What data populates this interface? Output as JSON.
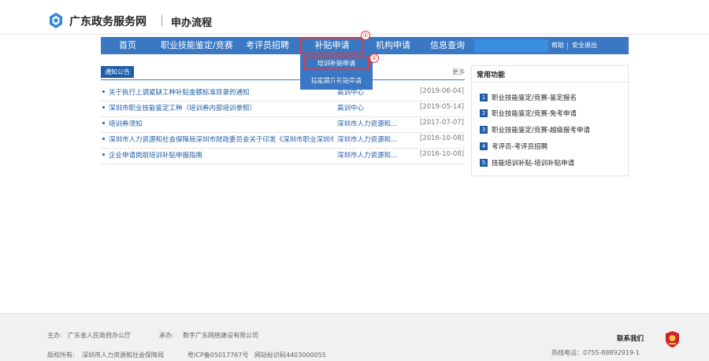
{
  "header": {
    "site_title": "广东政务服务网",
    "page_title": "申办流程"
  },
  "nav": {
    "items": [
      "首页",
      "职业技能鉴定/竞赛",
      "考评员招聘",
      "补贴申请",
      "机构申请",
      "信息查询"
    ],
    "active_item": "补贴申请",
    "search_value": "",
    "help_label": "帮助",
    "logout_label": "安全退出"
  },
  "dropdown": {
    "items": [
      "培训补贴申请",
      "技能提升补贴申请"
    ]
  },
  "markers": [
    "①",
    "②"
  ],
  "notices": {
    "tag": "通知公告",
    "more": "更多",
    "items": [
      {
        "title": "关于执行上调紧缺工种补贴金额标准目录的通知",
        "source": "高训中心",
        "date": "[2019-06-04]"
      },
      {
        "title": "深圳市职业技能鉴定工种（培训券内部培训参照）",
        "source": "高训中心",
        "date": "[2019-05-14]"
      },
      {
        "title": "培训券须知",
        "source": "深圳市人力资源和...",
        "date": "[2017-07-07]"
      },
      {
        "title": "深圳市人力资源和社会保障局深圳市财政委员会关于印发《深圳市职业深圳市人力资源和...",
        "source": "深圳市人力资源和...",
        "date": "[2016-10-08]"
      },
      {
        "title": "企业申请岗前培训补贴申报指南",
        "source": "深圳市人力资源和...",
        "date": "[2016-10-08]"
      }
    ]
  },
  "functions": {
    "title": "常用功能",
    "items": [
      {
        "num": "1",
        "label": "职业技能鉴定/竞赛-鉴定报名"
      },
      {
        "num": "2",
        "label": "职业技能鉴定/竞赛-免考申请"
      },
      {
        "num": "3",
        "label": "职业技能鉴定/竞赛-越级报考申请"
      },
      {
        "num": "4",
        "label": "考评员-考评员招聘"
      },
      {
        "num": "5",
        "label": "技能培训补贴-培训补贴申请"
      }
    ]
  },
  "footer": {
    "host_label": "主办:",
    "host": "广东省人民政府办公厅",
    "undertake_label": "承办:",
    "undertake": "数字广东网络建设有限公司",
    "copyright_label": "版权所有:",
    "copyright": "深圳市人力资源和社会保障局",
    "icp": "粤ICP备05017767号",
    "site_code": "网站标识码4403000055",
    "contact": "联系我们",
    "hotline": "热线电话：0755-88892919-1"
  },
  "colors": {
    "nav_bg": "#3a78c3",
    "highlight": "#e5383b",
    "link": "#1f5da8"
  }
}
